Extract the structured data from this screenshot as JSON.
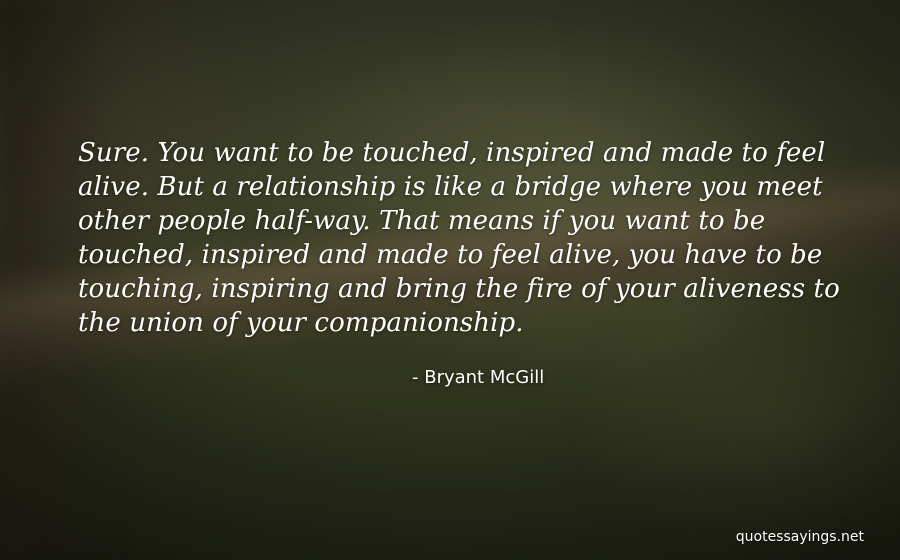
{
  "quote": {
    "lines": [
      "Sure. You want to be touched, inspired and made to feel",
      "alive. But a relationship is like a bridge where you meet",
      "other people half-way. That means if you want to be",
      "touched, inspired and made to feel alive, you have to be",
      "touching, inspiring and bring the fire of your aliveness to",
      "the union of your companionship."
    ]
  },
  "author": "- Bryant McGill",
  "watermark": "quotessayings.net"
}
